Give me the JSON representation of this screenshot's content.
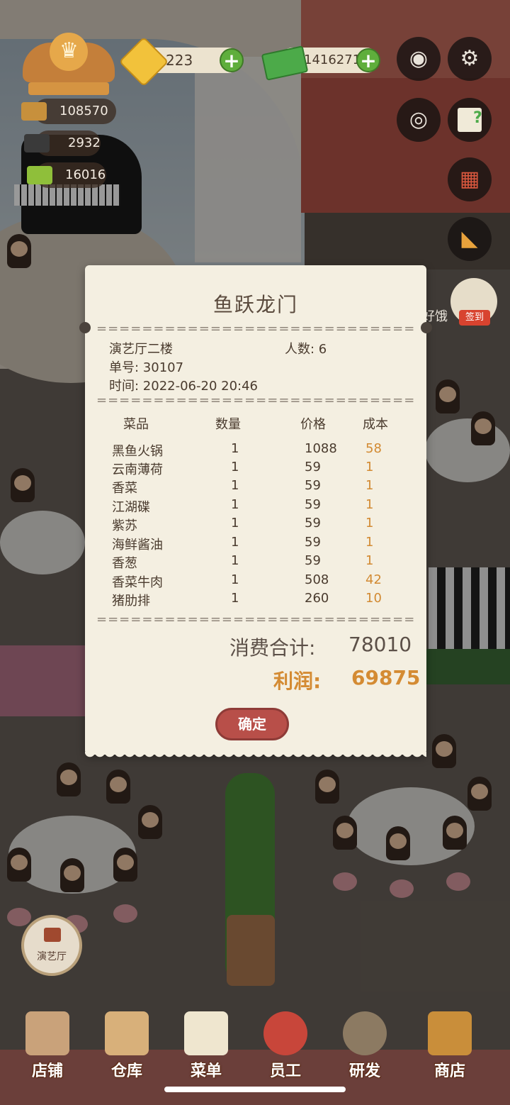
{
  "hud": {
    "level_icon": "chef-hat-crest-icon",
    "gems": "223",
    "cash": "1416271",
    "stat1": "108570",
    "stat2": "2932",
    "stat3": "16016",
    "buttons": [
      "camera-icon",
      "gear-icon",
      "eye-icon",
      "book-help-icon",
      "recipe-book-icon",
      "megaphone-icon"
    ],
    "signin_label": "签到",
    "side_text": "好饿"
  },
  "receipt": {
    "title": "鱼跃龙门",
    "hall": "演艺厅二楼",
    "people": "人数: 6",
    "order_no": "单号: 30107",
    "time": "时间: 2022-06-20 20:46",
    "headers": {
      "dish": "菜品",
      "qty": "数量",
      "price": "价格",
      "cost": "成本"
    },
    "items": [
      {
        "name": "黑鱼火锅",
        "qty": "1",
        "price": "1088",
        "cost": "58"
      },
      {
        "name": "云南薄荷",
        "qty": "1",
        "price": "59",
        "cost": "1"
      },
      {
        "name": "香菜",
        "qty": "1",
        "price": "59",
        "cost": "1"
      },
      {
        "name": "江湖碟",
        "qty": "1",
        "price": "59",
        "cost": "1"
      },
      {
        "name": "紫苏",
        "qty": "1",
        "price": "59",
        "cost": "1"
      },
      {
        "name": "海鲜酱油",
        "qty": "1",
        "price": "59",
        "cost": "1"
      },
      {
        "name": "香葱",
        "qty": "1",
        "price": "59",
        "cost": "1"
      },
      {
        "name": "香菜牛肉",
        "qty": "1",
        "price": "508",
        "cost": "42"
      },
      {
        "name": "猪肋排",
        "qty": "1",
        "price": "260",
        "cost": "10"
      }
    ],
    "total_label": "消费合计:",
    "total": "78010",
    "profit_label": "利润:",
    "profit": "69875",
    "confirm": "确定"
  },
  "hall_badge": "演艺厅",
  "nav": [
    {
      "label": "店铺",
      "icon": "shop-front-icon"
    },
    {
      "label": "仓库",
      "icon": "warehouse-boxes-icon"
    },
    {
      "label": "菜单",
      "icon": "menu-clipboard-icon"
    },
    {
      "label": "员工",
      "icon": "staff-avatar-icon"
    },
    {
      "label": "研发",
      "icon": "cooking-pot-icon"
    },
    {
      "label": "商店",
      "icon": "store-stall-icon"
    }
  ],
  "colors": {
    "profit": "#d48b33",
    "cost": "#d28a32",
    "confirm": "#b84f49",
    "plus": "#5fae3c"
  }
}
